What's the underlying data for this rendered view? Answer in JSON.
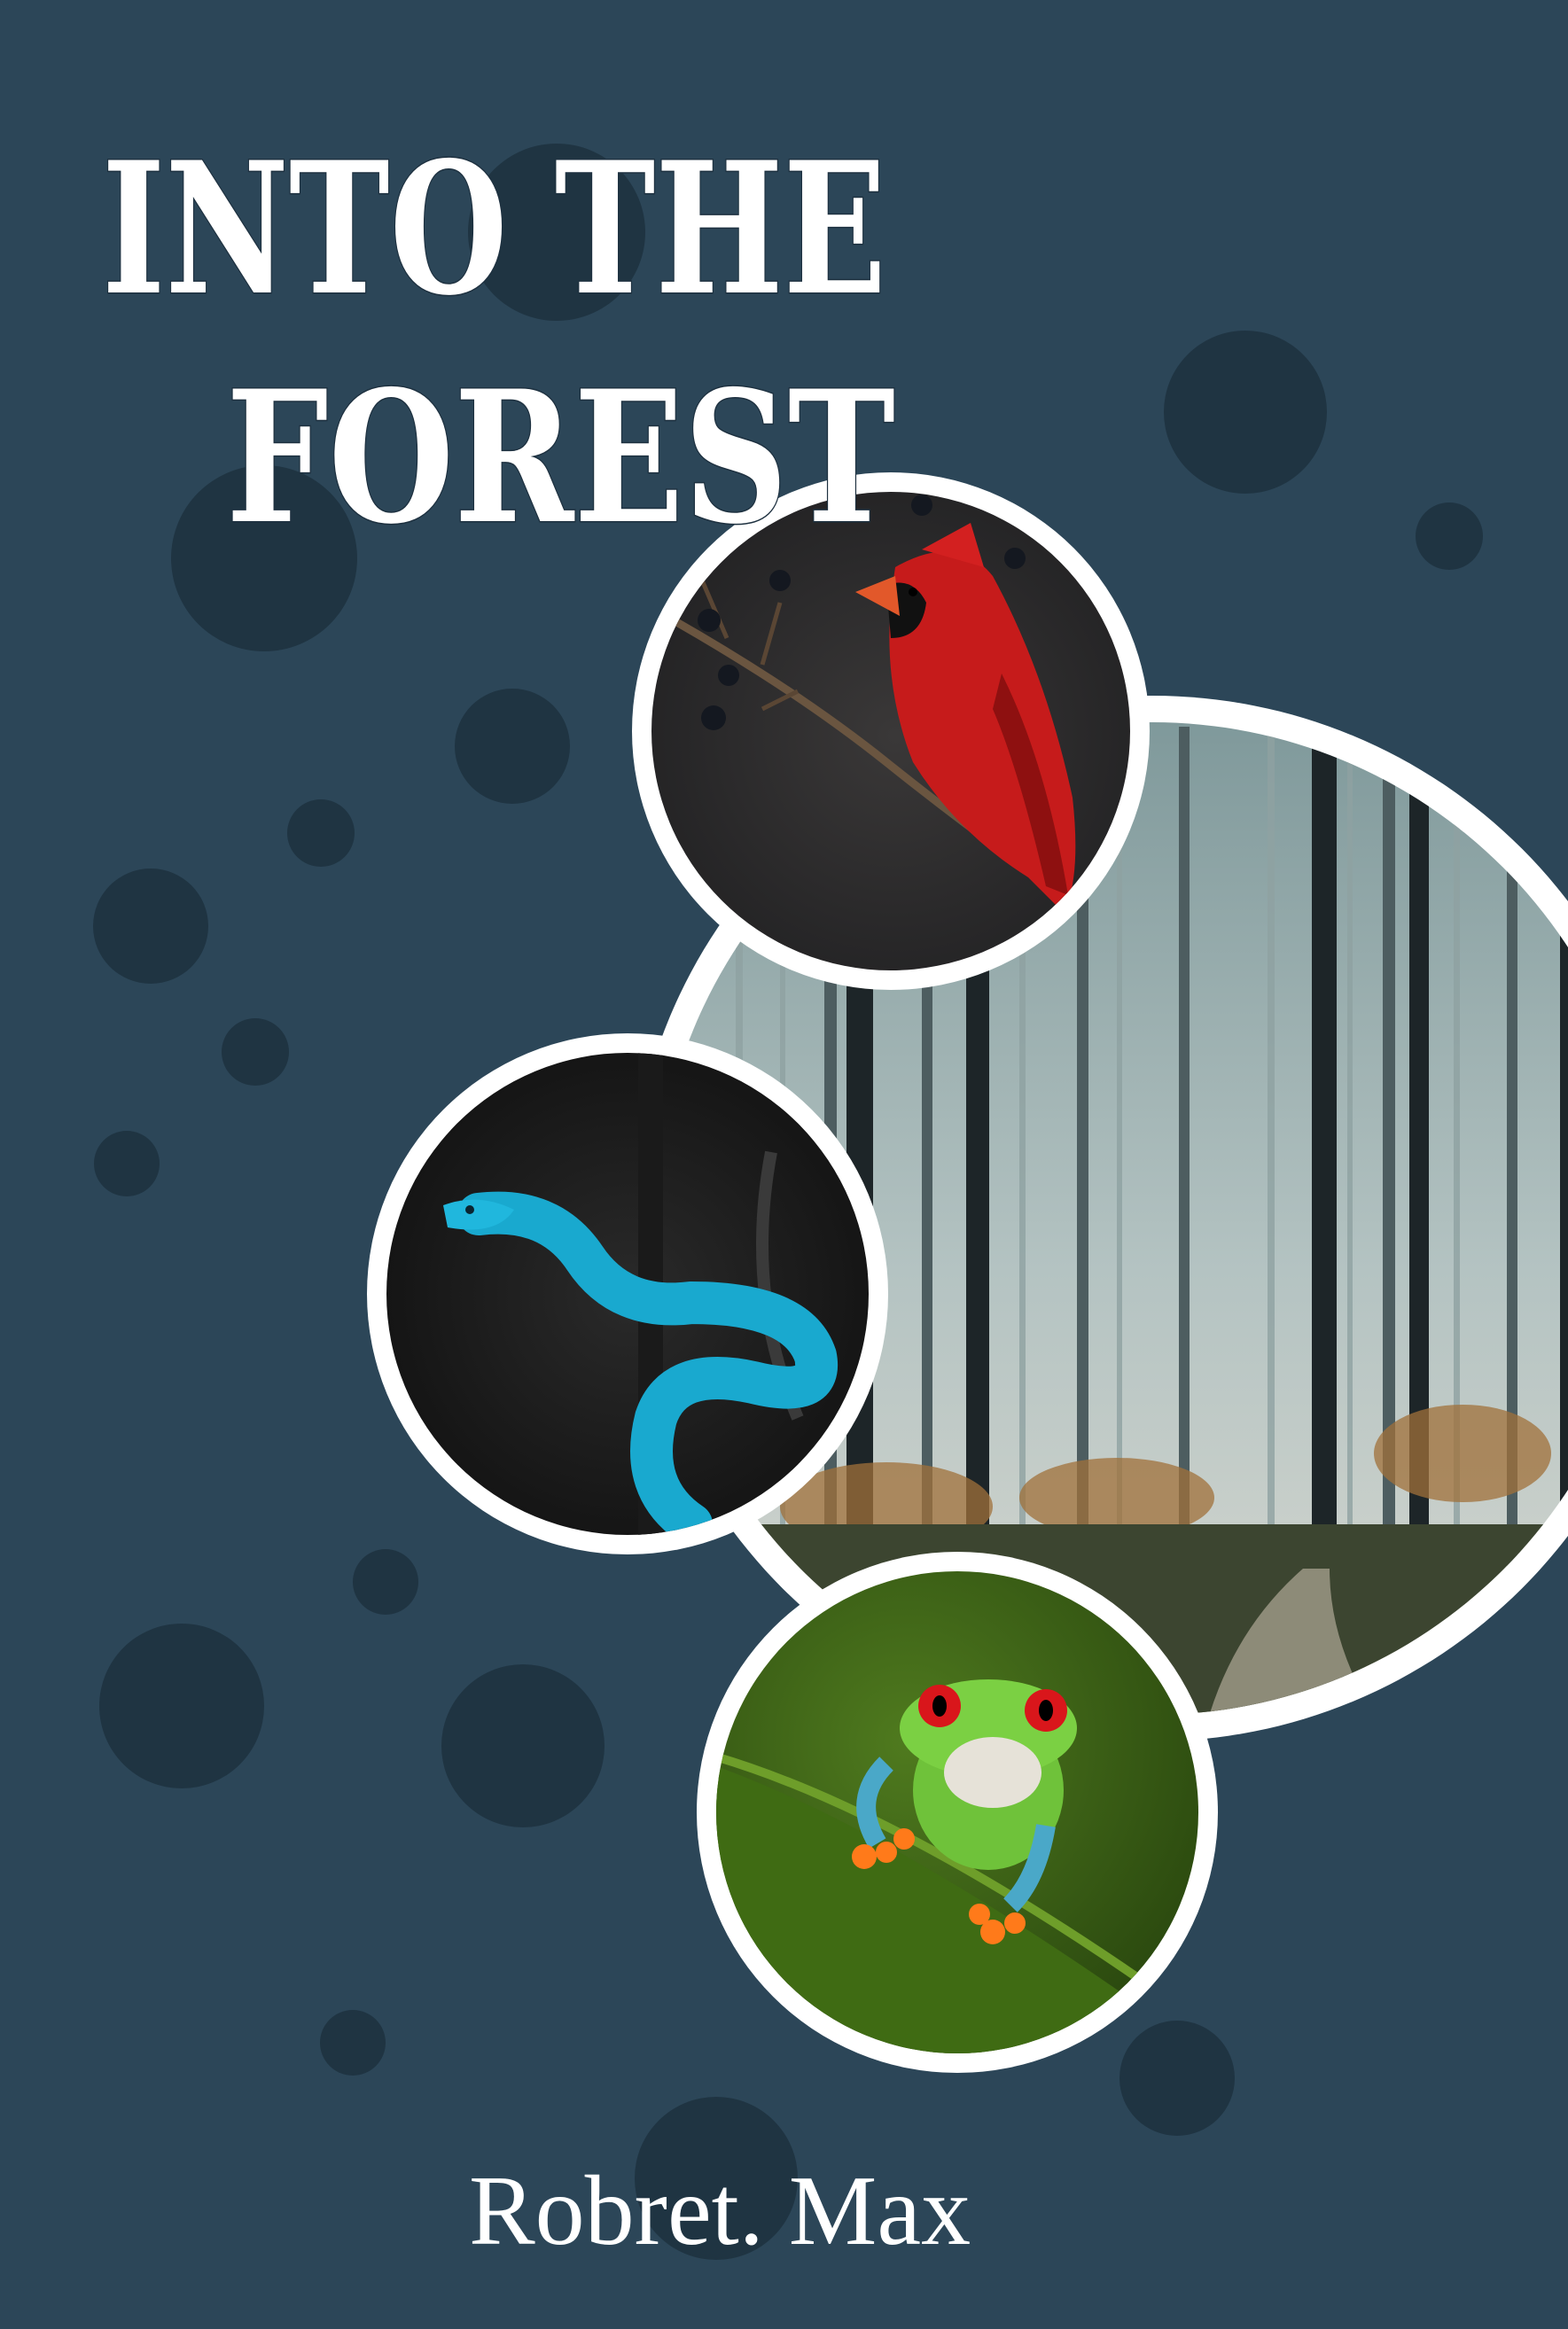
{
  "cover": {
    "title_line1": "INTO THE",
    "title_line2": "FOREST",
    "author": "Robret. Max"
  },
  "colors": {
    "background": "#2c4658",
    "dots": "#1f3442",
    "frame": "#ffffff",
    "title": "#ffffff"
  },
  "photos": [
    {
      "subject": "cardinal-bird",
      "icon": "red-bird-icon"
    },
    {
      "subject": "foggy-forest",
      "icon": "forest-icon"
    },
    {
      "subject": "blue-viper-snake",
      "icon": "snake-icon"
    },
    {
      "subject": "red-eyed-tree-frog",
      "icon": "frog-icon"
    }
  ]
}
